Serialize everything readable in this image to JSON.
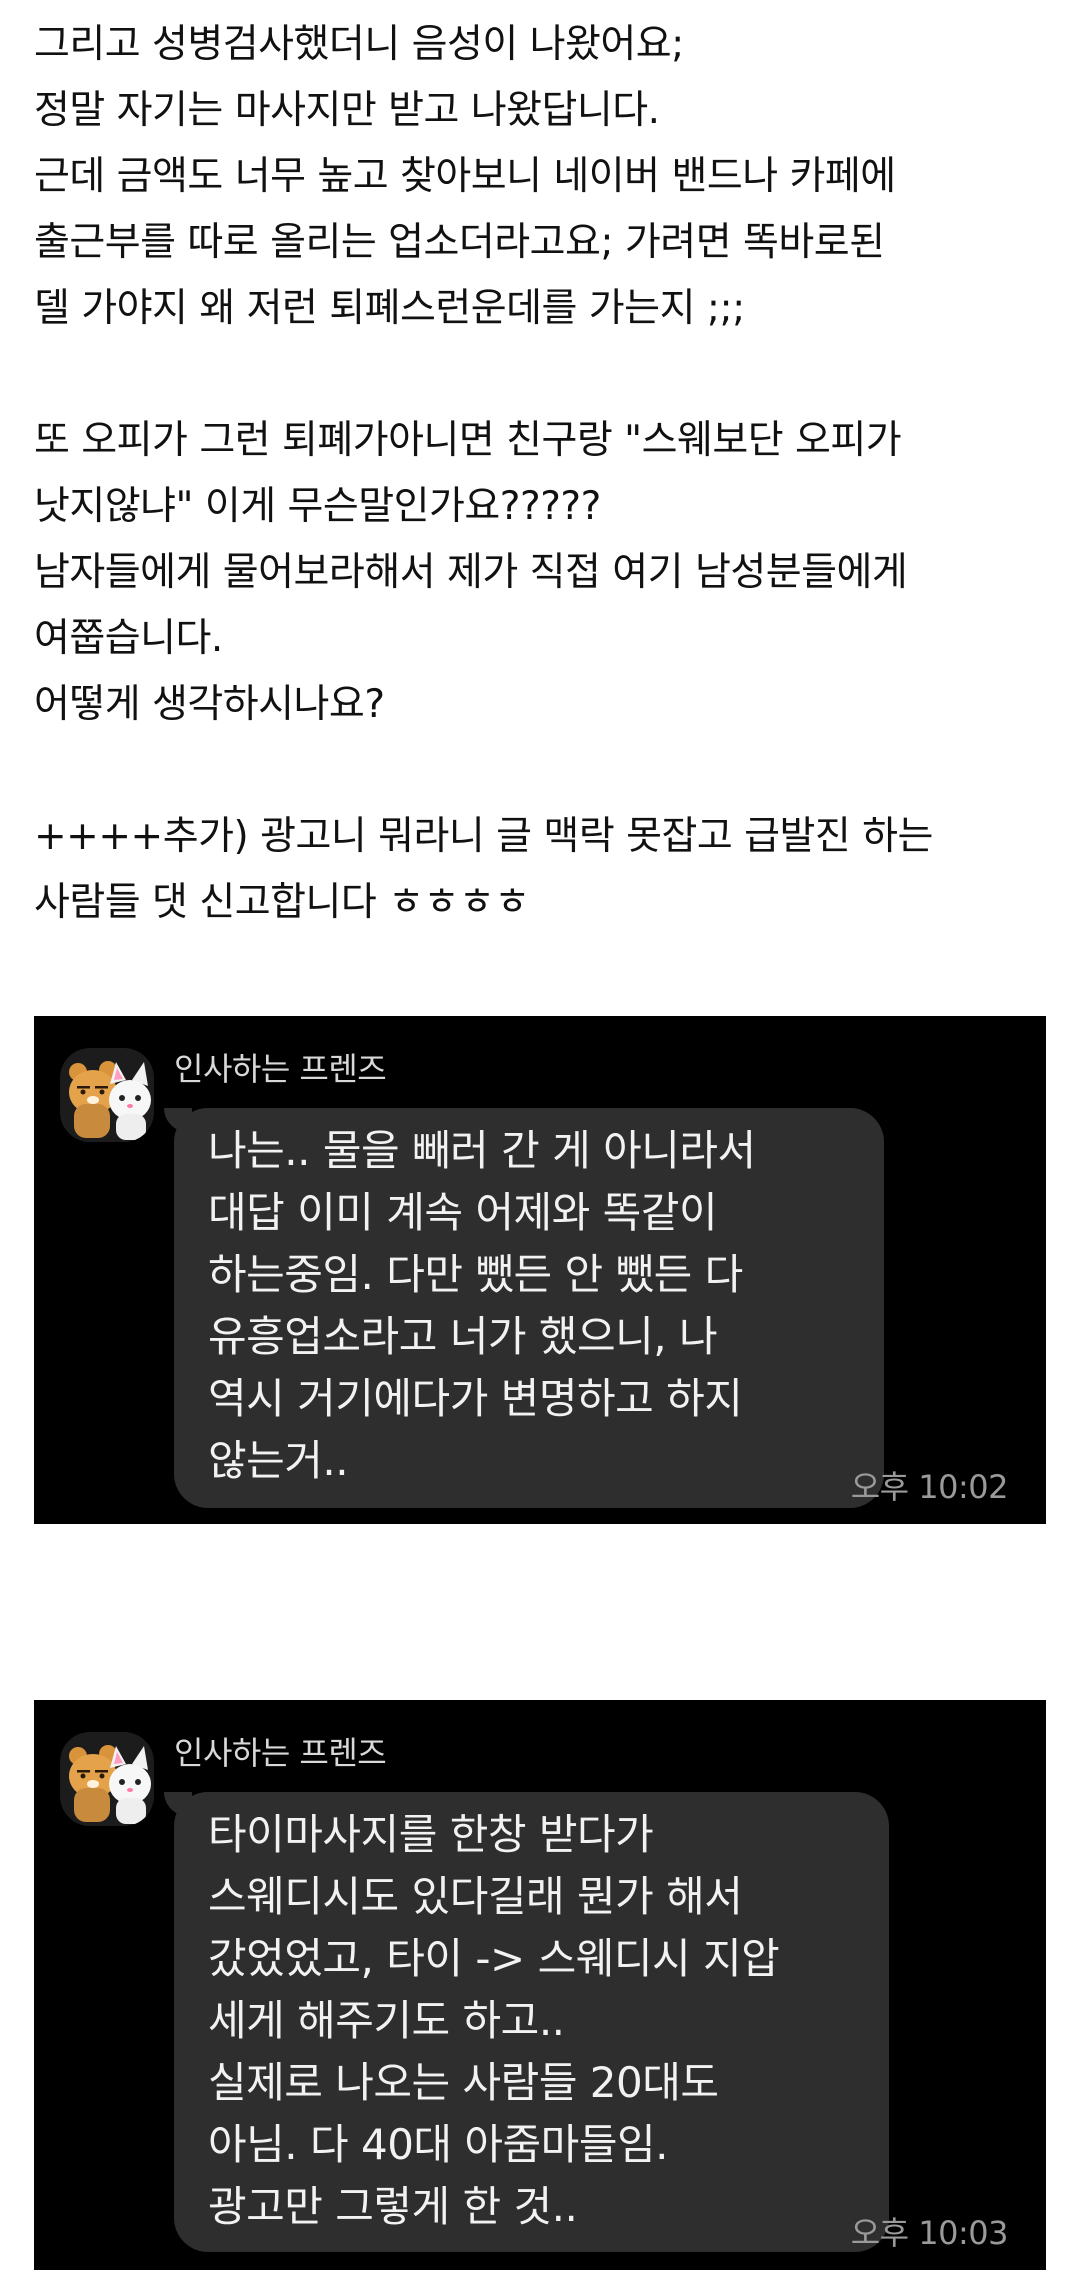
{
  "post": {
    "lines": [
      "그리고 성병검사했더니 음성이 나왔어요;",
      "정말 자기는 마사지만 받고 나왔답니다.",
      "근데 금액도 너무 높고 찾아보니 네이버 밴드나 카페에",
      "출근부를 따로 올리는 업소더라고요;  가려면 똑바로된",
      "델 가야지 왜 저런 퇴폐스런운데를 가는지 ;;;",
      "",
      "또 오피가 그런 퇴폐가아니면 친구랑 \"스웨보단 오피가",
      "낫지않냐\" 이게 무슨말인가요?????",
      "남자들에게 물어보라해서 제가 직접 여기 남성분들에게",
      "여쭙습니다.",
      "어떻게 생각하시나요?",
      "",
      "++++추가) 광고니 뭐라니 글 맥락 못잡고 급발진 하는",
      "사람들 댓 신고합니다 ㅎㅎㅎㅎ"
    ]
  },
  "chats": [
    {
      "sender": "인사하는 프렌즈",
      "avatar_icon": "kakao-friends-avatar-icon",
      "message_lines": [
        "나는.. 물을 빼러 간 게 아니라서",
        "대답 이미 계속 어제와 똑같이",
        "하는중임. 다만 뺐든 안 뺐든 다",
        "유흥업소라고 너가 했으니, 나",
        "역시 거기에다가 변명하고 하지",
        "않는거.."
      ],
      "time": "오후 10:02"
    },
    {
      "sender": "인사하는 프렌즈",
      "avatar_icon": "kakao-friends-avatar-icon",
      "message_lines": [
        "타이마사지를 한창 받다가",
        "스웨디시도 있다길래 뭔가 해서",
        "갔었었고, 타이 -> 스웨디시 지압",
        "세게 해주기도 하고..",
        "실제로 나오는 사람들 20대도",
        "아님. 다 40대 아줌마들임.",
        "광고만 그렇게 한 것.."
      ],
      "time": "오후 10:03"
    }
  ],
  "colors": {
    "page_bg": "#ffffff",
    "chat_bg": "#000000",
    "bubble_bg": "#2e2e2e",
    "bubble_text": "#f2f2f2",
    "time_text": "#9a9a9a"
  }
}
